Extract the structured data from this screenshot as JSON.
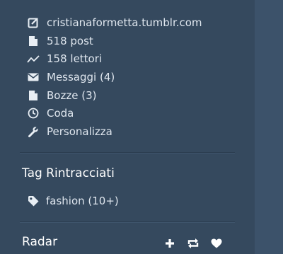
{
  "menu": [
    {
      "label": "cristianaformetta.tumblr.com",
      "icon": "external-link-icon"
    },
    {
      "label": "518 post",
      "icon": "document-icon"
    },
    {
      "label": "158 lettori",
      "icon": "activity-chart-icon"
    },
    {
      "label": "Messaggi (4)",
      "icon": "envelope-icon"
    },
    {
      "label": "Bozze (3)",
      "icon": "document-icon"
    },
    {
      "label": "Coda",
      "icon": "clock-icon"
    },
    {
      "label": "Personalizza",
      "icon": "wrench-icon"
    }
  ],
  "tracked_tags": {
    "title": "Tag Rintracciati",
    "items": [
      {
        "label": "fashion (10+)",
        "icon": "tag-icon"
      }
    ]
  },
  "radar": {
    "title": "Radar",
    "actions": [
      {
        "icon": "plus-icon"
      },
      {
        "icon": "reblog-icon"
      },
      {
        "icon": "heart-icon"
      }
    ]
  },
  "colors": {
    "background": "#35495e",
    "text": "#dfe6ee",
    "title": "#ffffff",
    "icon": "#e8eef4"
  }
}
